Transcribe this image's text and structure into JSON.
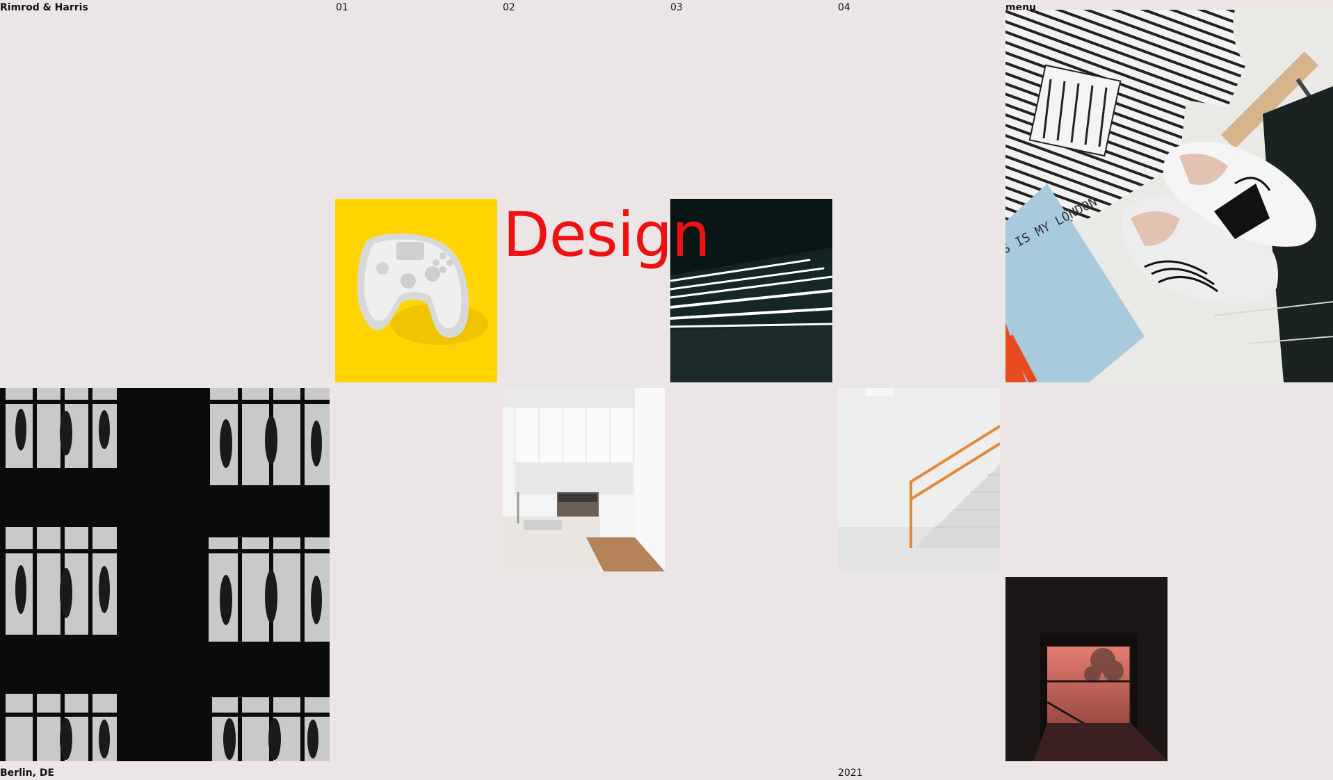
{
  "header": {
    "brand": "Rimrod & Harris",
    "nav": [
      "01",
      "02",
      "03",
      "04"
    ],
    "menu_label": "menu"
  },
  "hero": {
    "headline": "Design",
    "headline_color": "#ee1111"
  },
  "gallery": {
    "background": "#ebe6e5",
    "tiles": [
      {
        "name": "gamepad-photo",
        "accent": "#ffd400"
      },
      {
        "name": "light-stripes-photo",
        "accent": "#0b1a1a"
      },
      {
        "name": "fashion-flatlay-photo",
        "accent": "#f2f2f2"
      },
      {
        "name": "store-windows-photo",
        "accent": "#0b0b0b"
      },
      {
        "name": "kitchen-photo",
        "accent": "#f4f4f4"
      },
      {
        "name": "stairs-photo",
        "accent": "#f0f0f0"
      },
      {
        "name": "sunset-window-photo",
        "accent": "#1c1616"
      }
    ],
    "book_text": "S IS MY LONDON"
  },
  "footer": {
    "location": "Berlin, DE",
    "year": "2021"
  }
}
